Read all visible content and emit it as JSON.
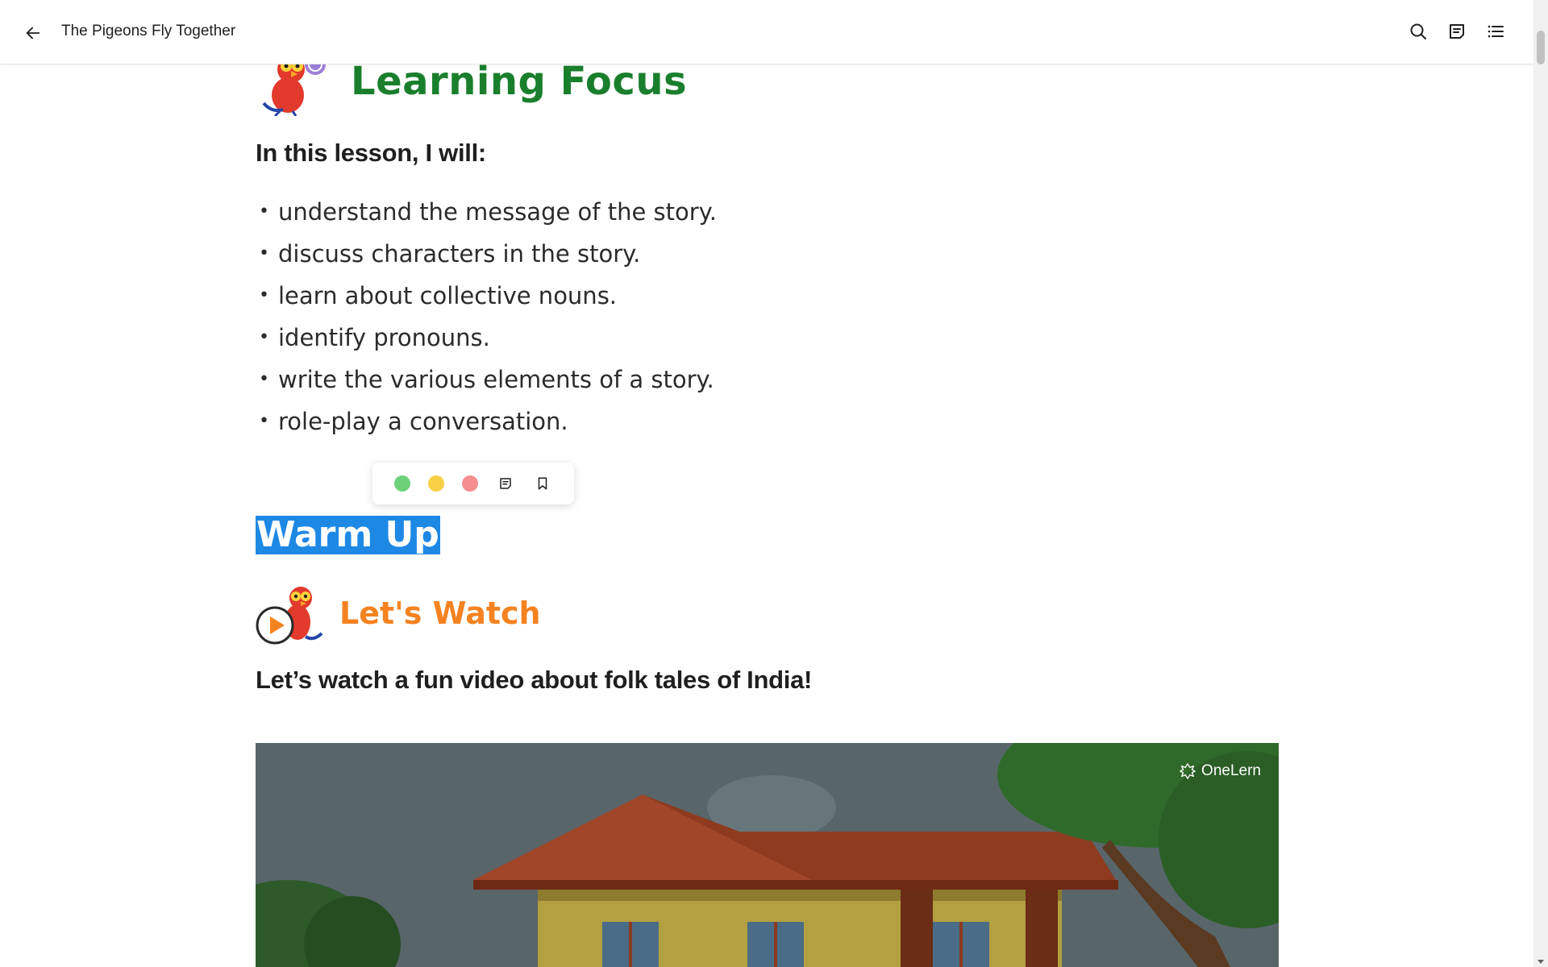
{
  "header": {
    "title": "The Pigeons Fly Together",
    "back_icon": "arrow-left-icon",
    "actions": [
      "search-icon",
      "notes-icon",
      "table-of-contents-icon"
    ]
  },
  "learning_focus": {
    "heading": "Learning Focus",
    "lead": "In this lesson, I will:",
    "items": [
      "understand the message of the story.",
      "discuss characters in the story.",
      "learn about collective nouns.",
      "identify pronouns.",
      "write the various elements of a story.",
      "role-play a conversation."
    ],
    "bullet": "•",
    "heading_color": "#1a7f2d"
  },
  "highlight_toolbar": {
    "colors": [
      "#6dd17a",
      "#f7d046",
      "#f58e8e"
    ],
    "actions": [
      "add-note-icon",
      "bookmark-icon"
    ]
  },
  "selected_text": "Warm Up",
  "lets_watch": {
    "heading": "Let's Watch",
    "lead": "Let’s watch a fun video about folk tales of India!",
    "heading_color": "#f58220"
  },
  "video": {
    "brand": "OneLern"
  }
}
